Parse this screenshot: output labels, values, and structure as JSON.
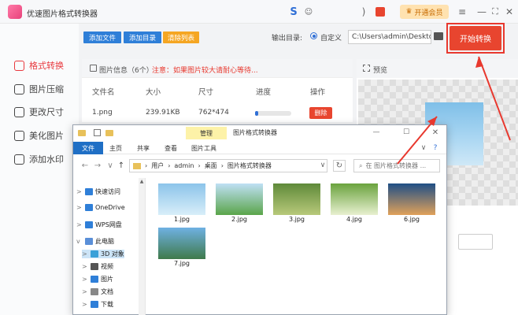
{
  "app": {
    "title": "优速图片格式转换器"
  },
  "titlebar": {
    "vip_label": "开通会员"
  },
  "sidebar": {
    "items": [
      {
        "label": "格式转换",
        "icon": "convert-icon"
      },
      {
        "label": "图片压缩",
        "icon": "compress-icon"
      },
      {
        "label": "更改尺寸",
        "icon": "resize-icon"
      },
      {
        "label": "美化图片",
        "icon": "beautify-icon"
      },
      {
        "label": "添加水印",
        "icon": "watermark-icon"
      }
    ]
  },
  "toolbar": {
    "add_file": "添加文件",
    "add_folder": "添加目录",
    "clear_list": "清除列表",
    "output_label": "输出目录:",
    "custom_label": "自定义",
    "output_path": "C:\\Users\\admin\\Deskto",
    "start_label": "开始转换"
  },
  "file_panel": {
    "info_title": "图片信息（6个）",
    "notice": "注意：如果图片较大请耐心等待...",
    "columns": [
      "文件名",
      "大小",
      "尺寸",
      "进度",
      "操作"
    ],
    "rows": [
      {
        "name": "1.png",
        "size": "239.91KB",
        "dims": "762*474",
        "progress": 0.08,
        "action": "删除"
      }
    ]
  },
  "preview": {
    "title": "预览"
  },
  "explorer": {
    "title": "图片格式转换器",
    "manage_tab": "管理",
    "picture_tools": "图片工具",
    "ribbon": [
      "文件",
      "主页",
      "共享",
      "查看"
    ],
    "breadcrumb": [
      "用户",
      "admin",
      "桌面",
      "图片格式转换器"
    ],
    "search_placeholder": "在 图片格式转换器 ...",
    "tree": [
      {
        "label": "快速访问",
        "chev": ">"
      },
      {
        "label": "OneDrive",
        "chev": ">"
      },
      {
        "label": "WPS网盘",
        "chev": ">"
      },
      {
        "label": "此电脑",
        "chev": "v"
      },
      {
        "label": "3D 对象",
        "chev": ">"
      },
      {
        "label": "视频",
        "chev": ">"
      },
      {
        "label": "图片",
        "chev": ">"
      },
      {
        "label": "文档",
        "chev": ">"
      },
      {
        "label": "下载",
        "chev": ">"
      }
    ],
    "files": [
      {
        "name": "1.jpg",
        "colors": [
          "#8cc4ea",
          "#d8eef9"
        ]
      },
      {
        "name": "2.jpg",
        "colors": [
          "#bfe0f5",
          "#5aa54a"
        ]
      },
      {
        "name": "3.jpg",
        "colors": [
          "#5f8a3a",
          "#b8c97a"
        ]
      },
      {
        "name": "4.jpg",
        "colors": [
          "#6aa33e",
          "#e8f0d0"
        ]
      },
      {
        "name": "6.jpg",
        "colors": [
          "#1f4f86",
          "#e0a15a"
        ]
      },
      {
        "name": "7.jpg",
        "colors": [
          "#6fb1e3",
          "#3f7a4b"
        ]
      }
    ]
  }
}
